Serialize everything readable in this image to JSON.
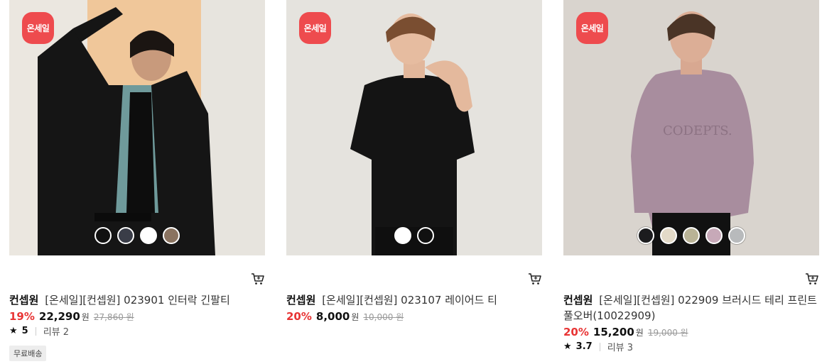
{
  "products": [
    {
      "badge": "온세일",
      "brand": "컨셉원",
      "name": "[온세일][컨셉원] 023901 인터락 긴팔티",
      "discount": "19%",
      "price": "22,290",
      "currency": "원",
      "original_price": "27,860",
      "original_currency": "원",
      "rating": "5",
      "reviews": "리뷰 2",
      "tag": "무료배송",
      "swatches": [
        "#111111",
        "#3a3d48",
        "#ffffff",
        "#8a7360"
      ]
    },
    {
      "badge": "온세일",
      "brand": "컨셉원",
      "name": "[온세일][컨셉원] 023107 레이어드 티",
      "discount": "20%",
      "price": "8,000",
      "currency": "원",
      "original_price": "10,000",
      "original_currency": "원",
      "swatches": [
        "#ffffff",
        "#111111"
      ]
    },
    {
      "badge": "온세일",
      "brand": "컨셉원",
      "name": "[온세일][컨셉원] 022909 브러시드 테리 프린트 풀오버(10022909)",
      "discount": "20%",
      "price": "15,200",
      "currency": "원",
      "original_price": "19,000",
      "original_currency": "원",
      "rating": "3.7",
      "reviews": "리뷰 3",
      "swatches": [
        "#1c1c1e",
        "#e3dac8",
        "#b9b396",
        "#c7a9b8",
        "#b8babc"
      ]
    }
  ],
  "colors": {
    "accent_sale": "#ee4b4e",
    "discount": "#e83434"
  },
  "icons": {
    "cart": "cart-icon",
    "star": "star-icon"
  }
}
